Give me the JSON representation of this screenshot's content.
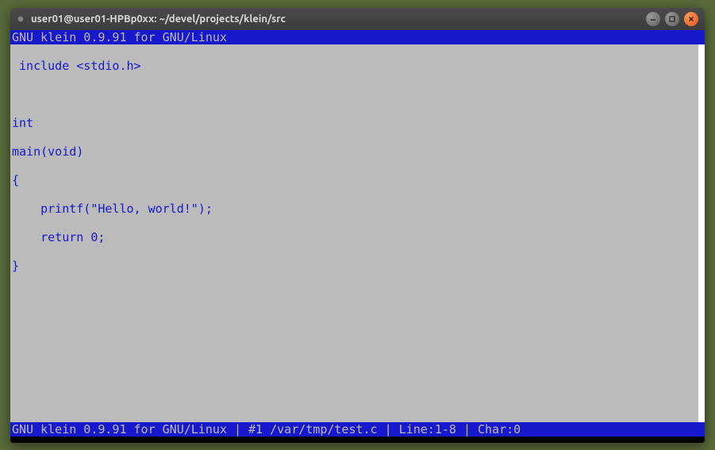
{
  "window": {
    "title": "user01@user01-HPBp0xx: ~/devel/projects/klein/src"
  },
  "editor": {
    "header": "GNU klein 0.9.91 for GNU/Linux",
    "footer": "GNU klein 0.9.91 for GNU/Linux | #1 /var/tmp/test.c | Line:1-8 | Char:0",
    "code": {
      "line1": " include <stdio.h>",
      "line2": "",
      "line3": "int",
      "line4": "main(void)",
      "line5": "{",
      "line6": "    printf(\"Hello, world!\");",
      "line7": "    return 0;",
      "line8": "}"
    }
  },
  "controls": {
    "minimize": "–",
    "maximize": "▫",
    "close": "×"
  }
}
